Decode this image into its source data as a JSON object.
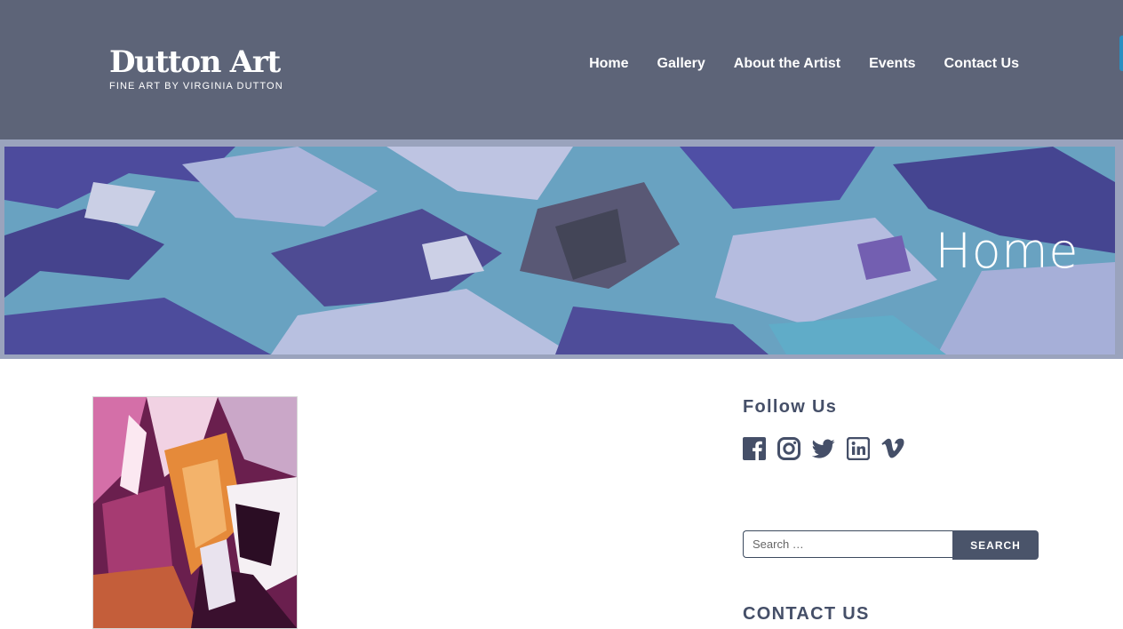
{
  "brand": {
    "title": "Dutton Art",
    "tagline": "FINE ART BY VIRGINIA DUTTON"
  },
  "nav": {
    "items": [
      {
        "label": "Home"
      },
      {
        "label": "Gallery"
      },
      {
        "label": "About the Artist"
      },
      {
        "label": "Events"
      },
      {
        "label": "Contact Us"
      }
    ]
  },
  "hero": {
    "title": "Home"
  },
  "sidebar": {
    "follow_title": "Follow Us",
    "social_icons": [
      "facebook-icon",
      "instagram-icon",
      "twitter-icon",
      "linkedin-icon",
      "vimeo-icon"
    ],
    "search": {
      "placeholder": "Search …",
      "button_label": "SEARCH"
    },
    "contact_title": "CONTACT US"
  },
  "colors": {
    "header_bg": "#5d6478",
    "heading_text": "#454f68",
    "search_button": "#4a546a"
  }
}
